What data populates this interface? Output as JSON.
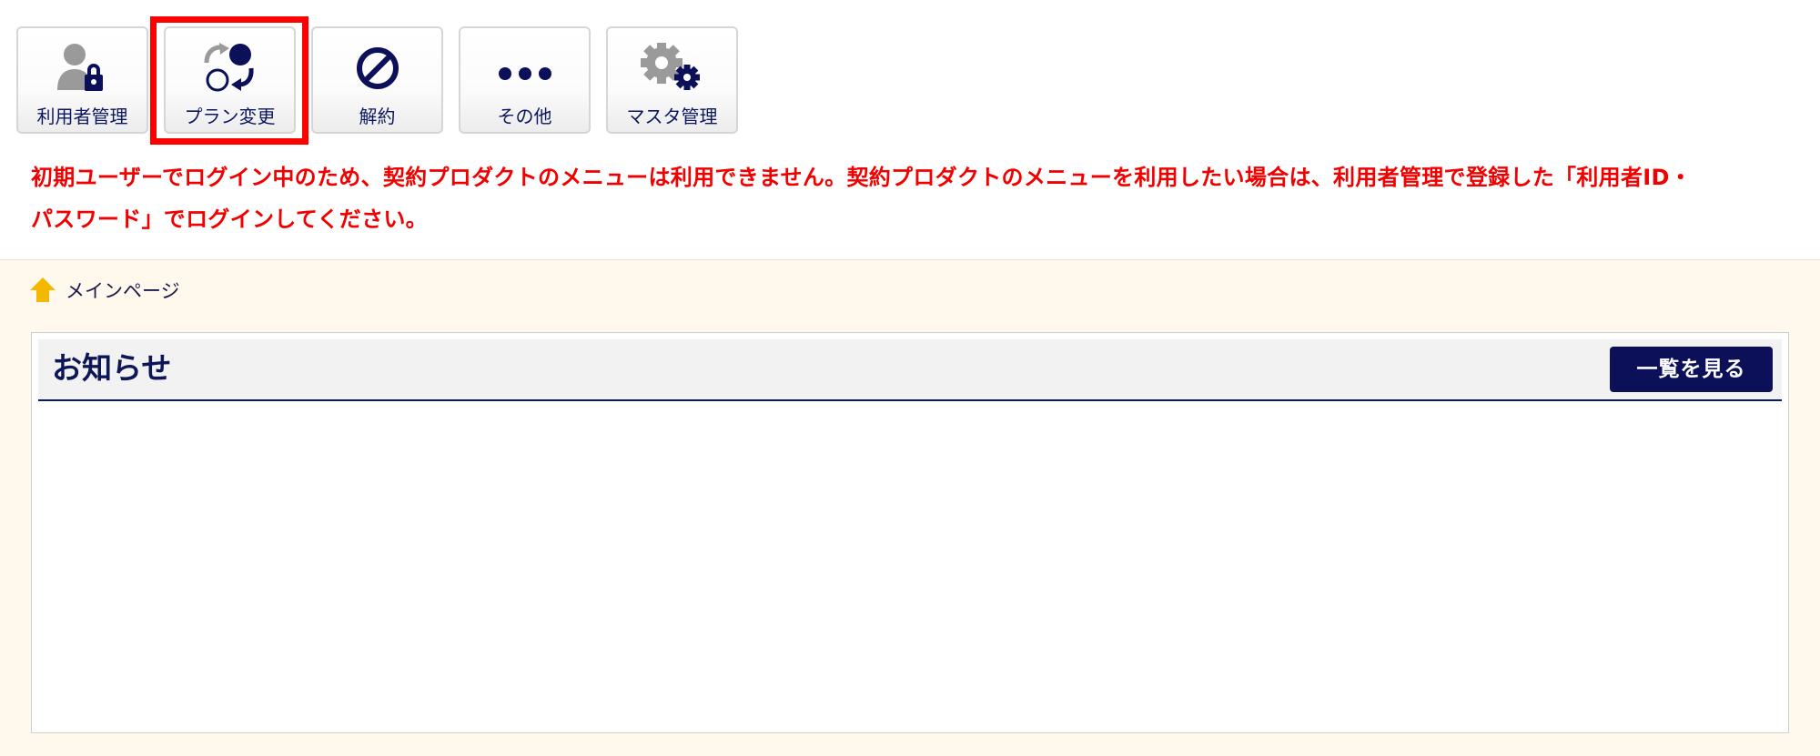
{
  "toolbar": {
    "buttons": [
      {
        "label": "利用者管理",
        "icon": "user-lock-icon"
      },
      {
        "label": "プラン変更",
        "icon": "plan-change-icon"
      },
      {
        "label": "解約",
        "icon": "prohibit-icon"
      },
      {
        "label": "その他",
        "icon": "more-dots-icon"
      },
      {
        "label": "マスタ管理",
        "icon": "gear-settings-icon"
      }
    ],
    "highlighted_button": "プラン変更"
  },
  "warning": {
    "line1": "初期ユーザーでログイン中のため、契約プロダクトのメニューは利用できません。契約プロダクトのメニューを利用したい場合は、利用者管理で登録した「利用者ID・",
    "line2": "パスワード」でログインしてください。"
  },
  "breadcrumb": {
    "home_label": "メインページ"
  },
  "notice": {
    "title": "お知らせ",
    "view_all_label": "一覧を見る"
  },
  "colors": {
    "navy": "#0b1059",
    "warning_red": "#f20000",
    "highlight_red": "#ff0000",
    "panel_bg": "#fff8ec",
    "home_icon": "#f5b800",
    "icon_gray": "#9a9a9a"
  }
}
